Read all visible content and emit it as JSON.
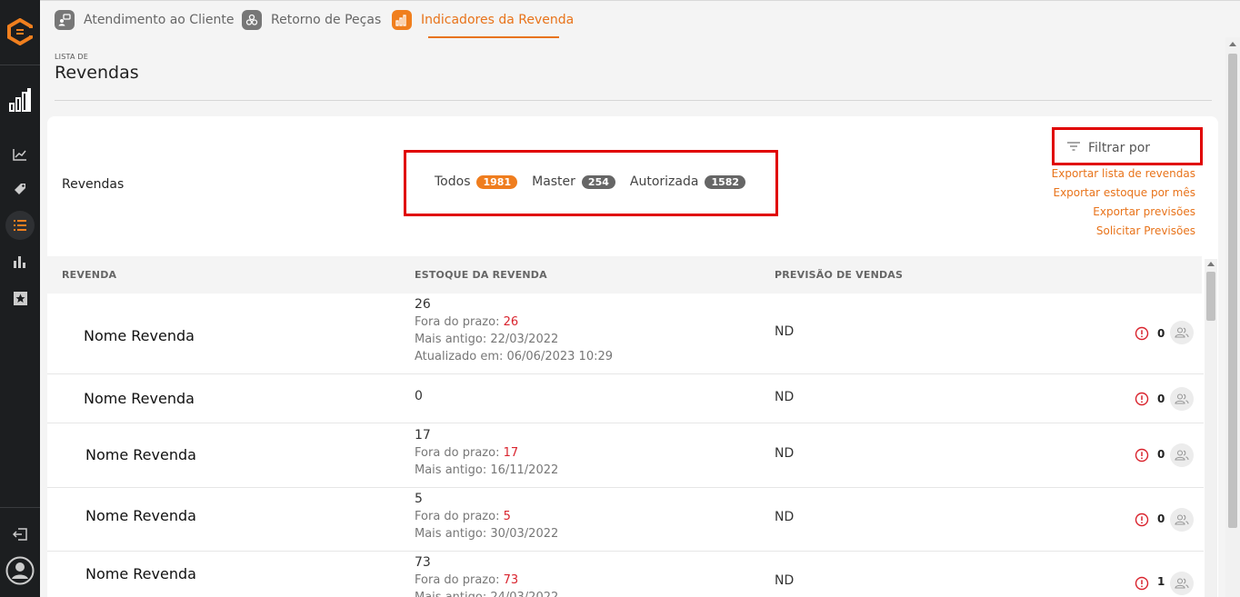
{
  "brand": {
    "accent": "#e8731a",
    "sidebar_bg": "#1c1e20",
    "highlight_red": "#e00000"
  },
  "tabs": [
    {
      "label": "Atendimento ao Cliente",
      "icon": "customer-service-icon"
    },
    {
      "label": "Retorno de Peças",
      "icon": "parts-return-icon"
    },
    {
      "label": "Indicadores da Revenda",
      "icon": "bar-chart-icon",
      "active": true
    }
  ],
  "sidebar": {
    "items": [
      {
        "icon": "dashboard-bars-icon"
      },
      {
        "icon": "line-chart-icon"
      },
      {
        "icon": "tag-icon"
      },
      {
        "icon": "list-icon",
        "active": true
      },
      {
        "icon": "bar-chart-icon"
      },
      {
        "icon": "star-icon"
      }
    ],
    "bottom": [
      {
        "icon": "logout-icon"
      },
      {
        "icon": "user-avatar-icon"
      }
    ]
  },
  "header": {
    "kicker": "LISTA DE",
    "title": "Revendas"
  },
  "card": {
    "label": "Revendas",
    "filters": [
      {
        "label": "Todos",
        "count": "1981",
        "active": true
      },
      {
        "label": "Master",
        "count": "254"
      },
      {
        "label": "Autorizada",
        "count": "1582"
      }
    ],
    "filter_by": "Filtrar por",
    "links": [
      "Exportar lista de revendas",
      "Exportar estoque por mês",
      "Exportar previsões",
      "Solicitar Previsões"
    ]
  },
  "table": {
    "columns": [
      "REVENDA",
      "ESTOQUE DA REVENDA",
      "PREVISÃO DE VENDAS"
    ],
    "rows": [
      {
        "name": "Nome Revenda",
        "stock": "26",
        "overdue_label": "Fora do prazo:",
        "overdue": "26",
        "oldest": "Mais antigo: 22/03/2022",
        "updated": "Atualizado em: 06/06/2023 10:29",
        "forecast": "ND",
        "alerts": "0"
      },
      {
        "name": "Nome Revenda",
        "stock": "0",
        "forecast": "ND",
        "alerts": "0"
      },
      {
        "name": "Nome Revenda",
        "stock": "17",
        "overdue_label": "Fora do prazo:",
        "overdue": "17",
        "oldest": "Mais antigo: 16/11/2022",
        "forecast": "ND",
        "alerts": "0"
      },
      {
        "name": "Nome Revenda",
        "stock": "5",
        "overdue_label": "Fora do prazo:",
        "overdue": "5",
        "oldest": "Mais antigo: 30/03/2022",
        "forecast": "ND",
        "alerts": "0"
      },
      {
        "name": "Nome Revenda",
        "stock": "73",
        "overdue_label": "Fora do prazo:",
        "overdue": "73",
        "oldest": "Mais antigo: 24/03/2022",
        "forecast": "ND",
        "alerts": "1"
      }
    ]
  }
}
